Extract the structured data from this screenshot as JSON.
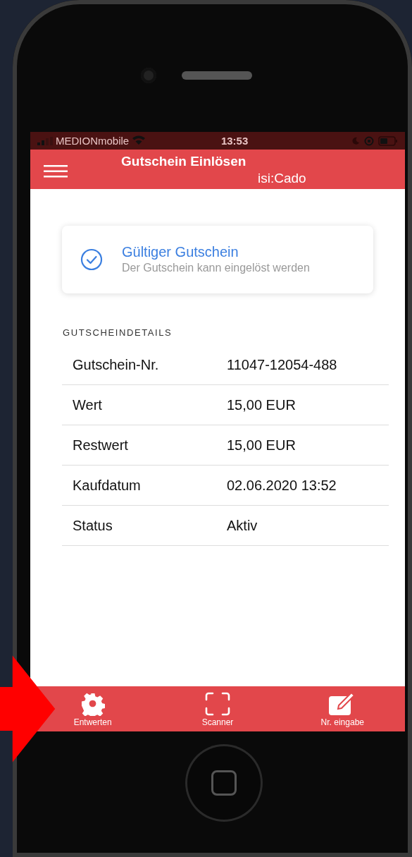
{
  "status_bar": {
    "carrier": "MEDIONmobile",
    "time": "13:53"
  },
  "header": {
    "title": "Gutschein Einlösen",
    "subtitle": "isi:Cado"
  },
  "status_card": {
    "title": "Gültiger Gutschein",
    "message": "Der Gutschein kann eingelöst werden"
  },
  "details": {
    "heading": "GUTSCHEINDETAILS",
    "rows": [
      {
        "label": "Gutschein-Nr.",
        "value": "11047-12054-488"
      },
      {
        "label": "Wert",
        "value": "15,00 EUR"
      },
      {
        "label": "Restwert",
        "value": "15,00 EUR"
      },
      {
        "label": "Kaufdatum",
        "value": "02.06.2020 13:52"
      },
      {
        "label": "Status",
        "value": "Aktiv"
      }
    ]
  },
  "tab_bar": [
    {
      "label": "Entwerten",
      "kind": "gear"
    },
    {
      "label": "Scanner",
      "kind": "scan"
    },
    {
      "label": "Nr. eingabe",
      "kind": "edit"
    }
  ]
}
